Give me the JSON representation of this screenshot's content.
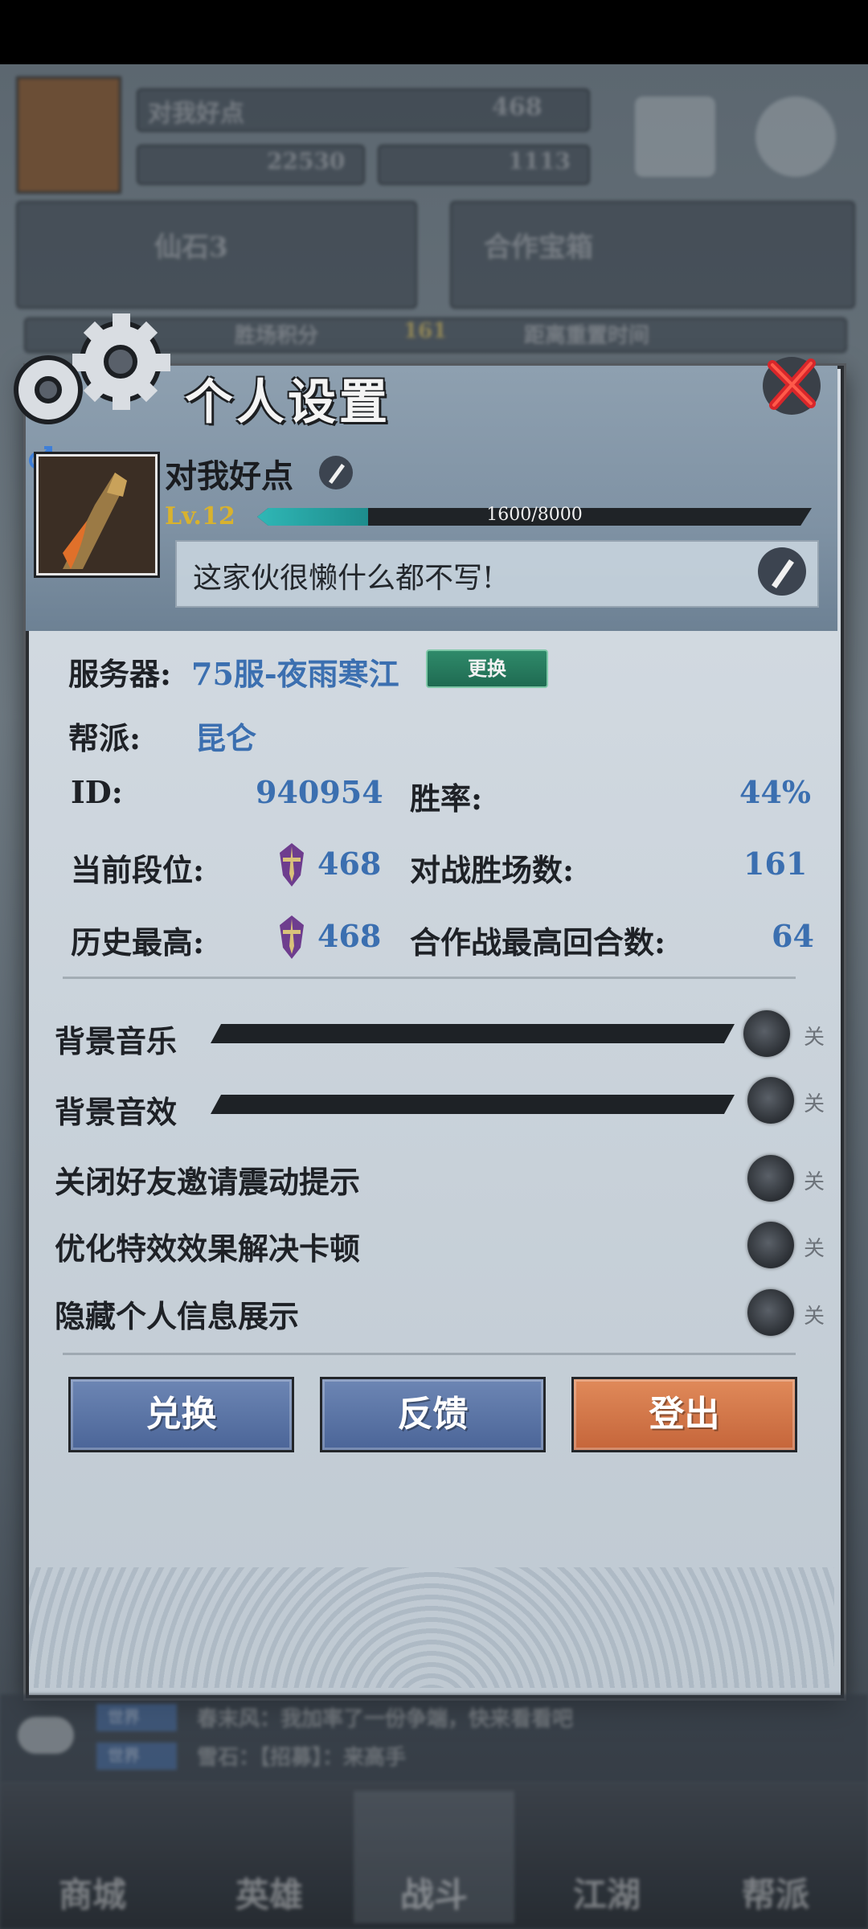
{
  "background": {
    "player_name": "对我好点",
    "rank_value": "468",
    "power": "22530",
    "gold": "1113",
    "panel_left": "仙石3",
    "panel_right": "合作宝箱",
    "banner_left": "胜场积分",
    "banner_value": "161",
    "banner_right": "距离重置时间",
    "chat": [
      {
        "channel": "世界",
        "text": "春末风：我加率了一份争端，快来看看吧"
      },
      {
        "channel": "世界",
        "text": "雪石：【招募】：来高手"
      }
    ],
    "tabs": [
      "商城",
      "英雄",
      "战斗",
      "江湖",
      "帮派"
    ]
  },
  "modal": {
    "title": "个人设置",
    "profile": {
      "nickname": "对我好点",
      "level": "Lv.12",
      "exp_text": "1600/8000",
      "exp_progress": 0.2,
      "signature": "这家伙很懒什么都不写!"
    },
    "info": {
      "server_label": "服务器:",
      "server_value": "75服-夜雨寒江",
      "change_label": "更换",
      "guild_label": "帮派:",
      "guild_value": "昆仑",
      "id_label": "ID:",
      "id_value": "940954",
      "winrate_label": "胜率:",
      "winrate_value": "44%",
      "rank_label": "当前段位:",
      "rank_value": "468",
      "wins_label": "对战胜场数:",
      "wins_value": "161",
      "best_label": "历史最高:",
      "best_value": "468",
      "coop_label": "合作战最高回合数:",
      "coop_value": "64"
    },
    "settings": [
      {
        "label": "背景音乐",
        "state": "关",
        "volume": 1.0
      },
      {
        "label": "背景音效",
        "state": "关",
        "volume": 1.0
      },
      {
        "label": "关闭好友邀请震动提示",
        "state": "关"
      },
      {
        "label": "优化特效效果解决卡顿",
        "state": "关"
      },
      {
        "label": "隐藏个人信息展示",
        "state": "关"
      }
    ],
    "buttons": {
      "redeem": "兑换",
      "feedback": "反馈",
      "logout": "登出"
    }
  },
  "colors": {
    "accent_blue": "#3b6fb0",
    "level_gold": "#d8b22e",
    "exp_teal": "#2fb7b6",
    "logout_orange": "#c5653a",
    "button_blue": "#4b6598"
  }
}
